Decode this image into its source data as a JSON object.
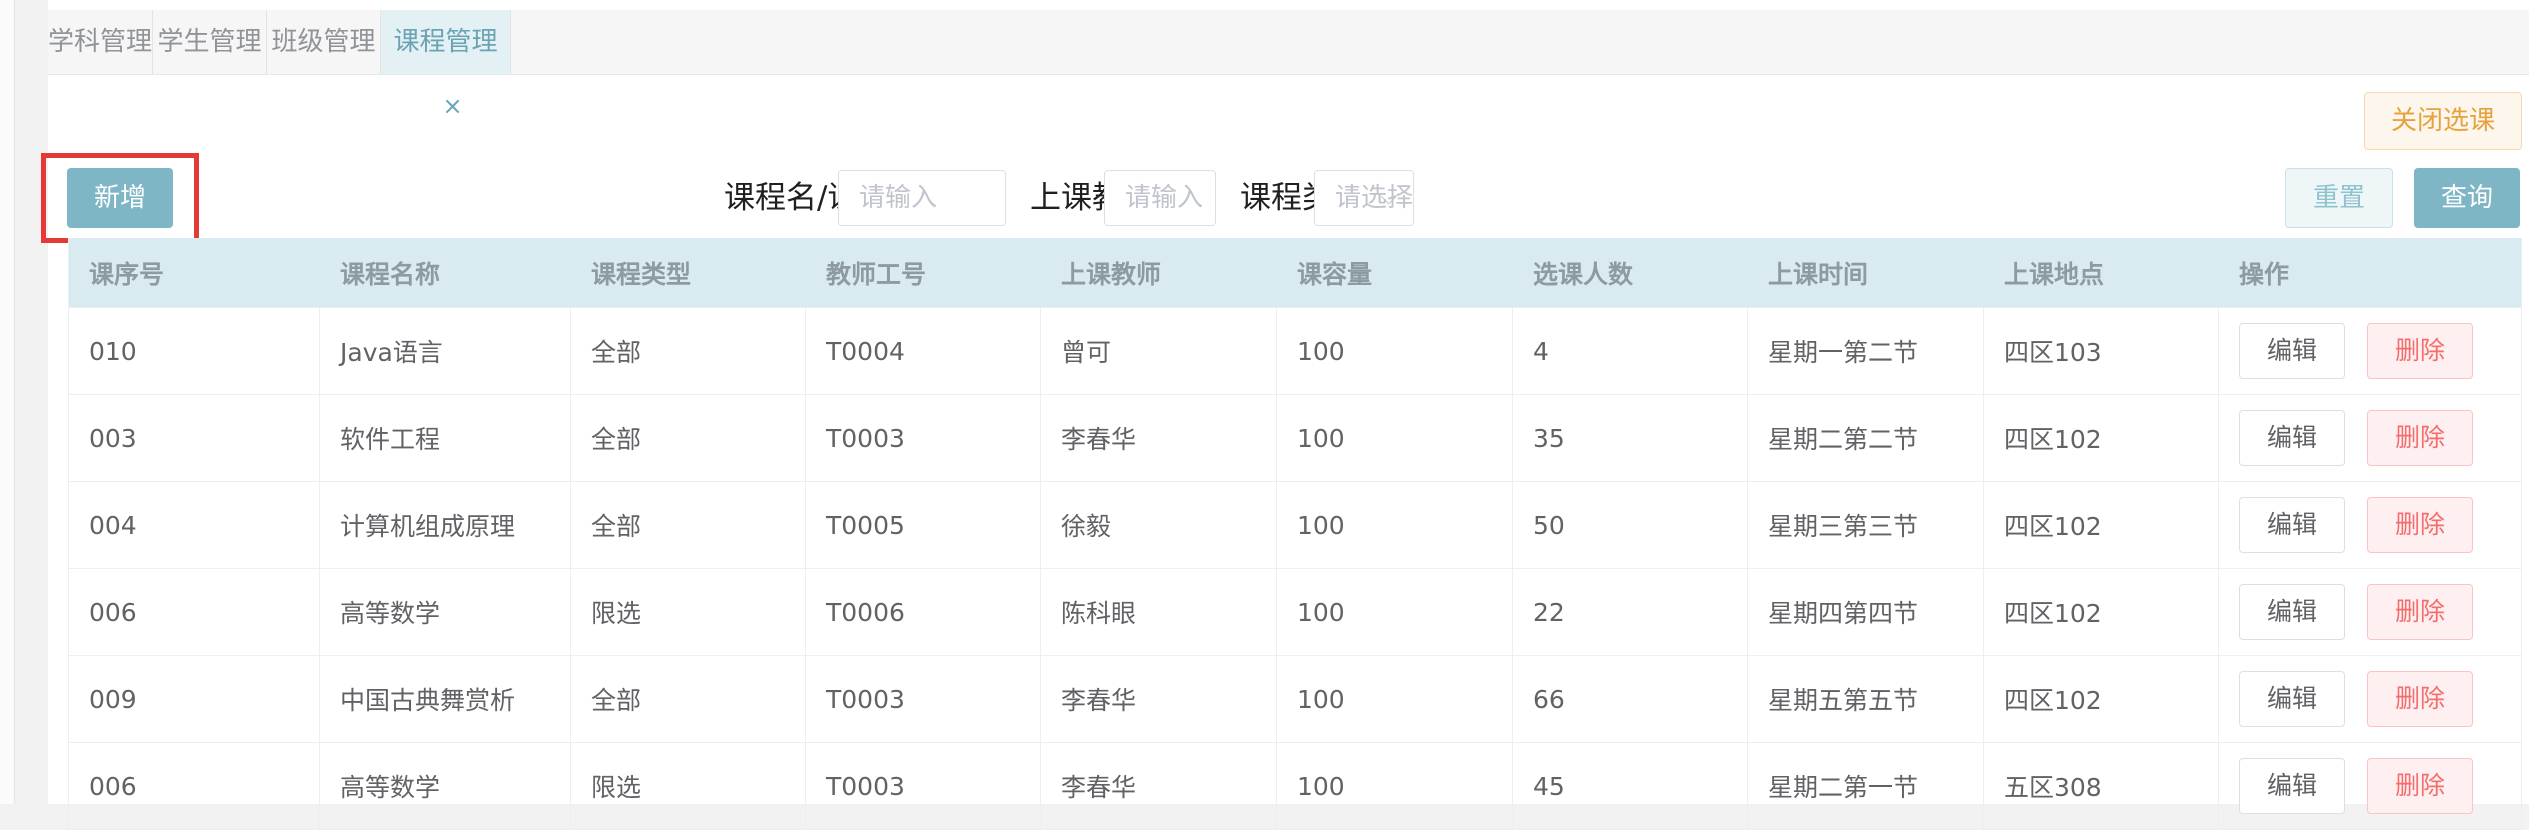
{
  "tabs": [
    {
      "label": "学科管理",
      "active": false
    },
    {
      "label": "学生管理",
      "active": false
    },
    {
      "label": "班级管理",
      "active": false
    },
    {
      "label": "课程管理",
      "active": true,
      "close": "×"
    }
  ],
  "toolbar": {
    "close_selection_label": "关闭选课",
    "add_label": "新增",
    "reset_label": "重置",
    "query_label": "查询"
  },
  "filters": {
    "course_label": "课程名/课序号",
    "course_placeholder": "请输入",
    "teacher_label": "上课教师",
    "teacher_placeholder": "请输入",
    "type_label": "课程类型",
    "type_placeholder": "请选择"
  },
  "table": {
    "headers": [
      "课序号",
      "课程名称",
      "课程类型",
      "教师工号",
      "上课教师",
      "课容量",
      "选课人数",
      "上课时间",
      "上课地点",
      "操作"
    ],
    "edit_label": "编辑",
    "delete_label": "删除",
    "rows": [
      [
        "010",
        "Java语言",
        "全部",
        "T0004",
        "曾可",
        "100",
        "4",
        "星期一第二节",
        "四区103"
      ],
      [
        "003",
        "软件工程",
        "全部",
        "T0003",
        "李春华",
        "100",
        "35",
        "星期二第二节",
        "四区102"
      ],
      [
        "004",
        "计算机组成原理",
        "全部",
        "T0005",
        "徐毅",
        "100",
        "50",
        "星期三第三节",
        "四区102"
      ],
      [
        "006",
        "高等数学",
        "限选",
        "T0006",
        "陈科眼",
        "100",
        "22",
        "星期四第四节",
        "四区102"
      ],
      [
        "009",
        "中国古典舞赏析",
        "全部",
        "T0003",
        "李春华",
        "100",
        "66",
        "星期五第五节",
        "四区102"
      ],
      [
        "006",
        "高等数学",
        "限选",
        "T0003",
        "李春华",
        "100",
        "45",
        "星期二第一节",
        "五区308"
      ]
    ]
  },
  "colors": {
    "primary": "#7fb6c5",
    "header_bg": "#d9ebf1",
    "danger": "#f56c6c",
    "warning": "#e6a23c",
    "highlight": "#e53935"
  }
}
